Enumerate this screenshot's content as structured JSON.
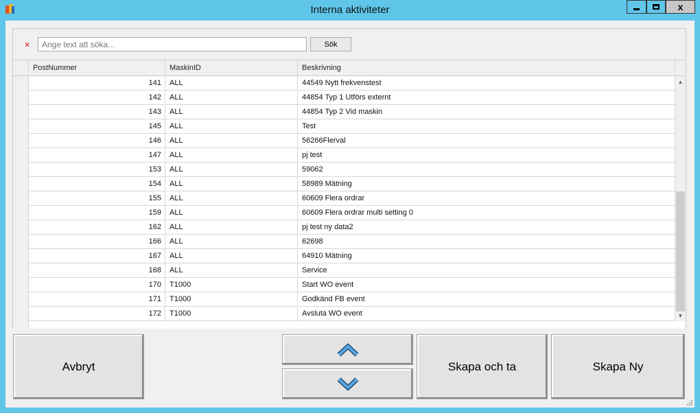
{
  "window": {
    "title": "Interna aktiviteter",
    "close_glyph": "x"
  },
  "search": {
    "clear_glyph": "×",
    "placeholder": "Ange text att söka...",
    "value": "",
    "button_label": "Sök"
  },
  "grid": {
    "columns": [
      "PostNummer",
      "MaskinID",
      "Beskrivning"
    ],
    "rows": [
      {
        "num": "141",
        "machine": "ALL",
        "desc": "44549 Nytt frekvenstest"
      },
      {
        "num": "142",
        "machine": "ALL",
        "desc": "44854 Typ 1 Utförs externt"
      },
      {
        "num": "143",
        "machine": "ALL",
        "desc": "44854 Typ 2 Vid maskin"
      },
      {
        "num": "145",
        "machine": "ALL",
        "desc": "Test"
      },
      {
        "num": "146",
        "machine": "ALL",
        "desc": "56266Flerval"
      },
      {
        "num": "147",
        "machine": "ALL",
        "desc": "pj test"
      },
      {
        "num": "153",
        "machine": "ALL",
        "desc": "59062"
      },
      {
        "num": "154",
        "machine": "ALL",
        "desc": "58989 Mätning"
      },
      {
        "num": "155",
        "machine": "ALL",
        "desc": "60609 Flera ordrar"
      },
      {
        "num": "159",
        "machine": "ALL",
        "desc": "60609 Flera ordrar multi setting 0"
      },
      {
        "num": "162",
        "machine": "ALL",
        "desc": "pj test ny data2"
      },
      {
        "num": "166",
        "machine": "ALL",
        "desc": "62698"
      },
      {
        "num": "167",
        "machine": "ALL",
        "desc": "64910 Mätning"
      },
      {
        "num": "168",
        "machine": "ALL",
        "desc": "Service"
      },
      {
        "num": "170",
        "machine": "T1000",
        "desc": "Start WO event"
      },
      {
        "num": "171",
        "machine": "T1000",
        "desc": "Godkänd FB event"
      },
      {
        "num": "172",
        "machine": "T1000",
        "desc": "Avsluta WO event"
      }
    ]
  },
  "buttons": {
    "cancel": "Avbryt",
    "create_and_take": "Skapa och ta",
    "create_new": "Skapa Ny"
  },
  "icons": {
    "app": "app-icon",
    "clear": "clear-search-icon",
    "up": "chevron-up-icon",
    "down": "chevron-down-icon"
  },
  "colors": {
    "title_bar": "#5fc6e9",
    "clear_icon": "#d83a3a",
    "chevron_fill": "#4a90c8"
  }
}
